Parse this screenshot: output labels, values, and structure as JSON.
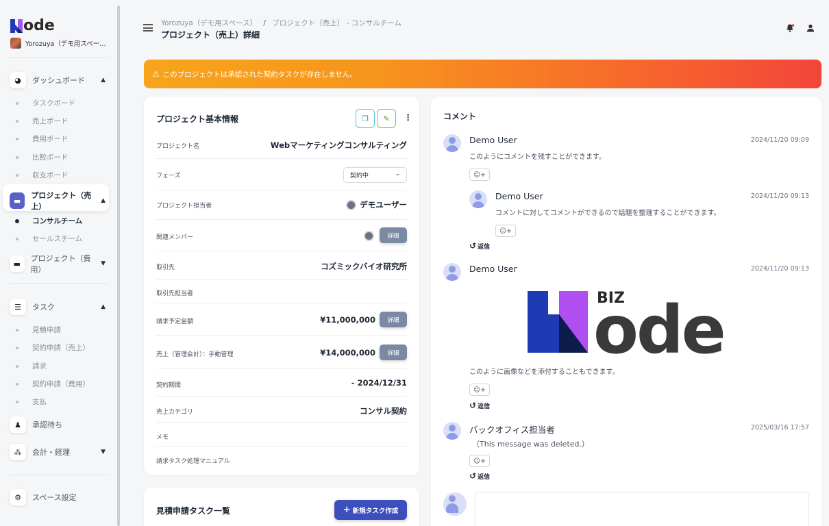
{
  "app": {
    "logo_text": "ode",
    "workspace": "Yorozuya（デモ用スペー…"
  },
  "sidebar": {
    "dashboard": {
      "label": "ダッシュボード",
      "items": [
        "タスクボード",
        "売上ボード",
        "費用ボード",
        "比較ボード",
        "収支ボード"
      ]
    },
    "project_sales": {
      "label": "プロジェクト（売上）",
      "items": [
        "コンサルチーム",
        "セールスチーム"
      ]
    },
    "project_cost": {
      "label": "プロジェクト（費用）"
    },
    "tasks": {
      "label": "タスク",
      "items": [
        "見積申請",
        "契約申請（売上）",
        "請求",
        "契約申請（費用）",
        "支払"
      ]
    },
    "approval": {
      "label": "承認待ち"
    },
    "accounting": {
      "label": "会計・経理"
    },
    "space_settings": {
      "label": "スペース設定"
    }
  },
  "header": {
    "breadcrumb_1": "Yorozuya（デモ用スペース）",
    "breadcrumb_sep": "/",
    "breadcrumb_2": "プロジェクト（売上） - コンサルチーム",
    "title": "プロジェクト（売上）詳細"
  },
  "alert": {
    "text": "このプロジェクトは承認された契約タスクが存在しません。"
  },
  "project_info": {
    "title": "プロジェクト基本情報",
    "rows": [
      {
        "label": "プロジェクト名",
        "value": "Webマーケティングコンサルティング"
      },
      {
        "label": "フェーズ",
        "value": "契約中"
      },
      {
        "label": "プロジェクト担当者",
        "value": "デモユーザー"
      },
      {
        "label": "関連メンバー",
        "value": "詳細"
      },
      {
        "label": "取引先",
        "value": "コズミックバイオ研究所"
      },
      {
        "label": "取引先担当者",
        "value": ""
      },
      {
        "label": "請求予定金額",
        "value": "¥11,000,000"
      },
      {
        "label": "売上（管理会計）：手動管理",
        "value": "¥14,000,000"
      },
      {
        "label": "契約期間",
        "value": "- 2024/12/31"
      },
      {
        "label": "売上カテゴリ",
        "value": "コンサル契約"
      },
      {
        "label": "メモ",
        "value": ""
      },
      {
        "label": "請求タスク処理マニュアル",
        "value": ""
      }
    ],
    "detail_label": "詳細"
  },
  "estimate_tasks": {
    "title": "見積申請タスク一覧",
    "new_button": "新規タスク作成"
  },
  "comments": {
    "title": "コメント",
    "reply_label": "返信",
    "react_label": "☺+",
    "items": [
      {
        "name": "Demo User",
        "date": "2024/11/20 09:09",
        "text": "このようにコメントを残すことができます。"
      },
      {
        "name": "Demo User",
        "date": "2024/11/20 09:13",
        "text": "コメントに対してコメントができるので話題を整理することができます。"
      },
      {
        "name": "Demo User",
        "date": "2024/11/20 09:13",
        "text": "このように画像などを添付することもできます。",
        "image_text": "BIZ"
      },
      {
        "name": "バックオフィス担当者",
        "date": "2025/03/16 17:57",
        "text": "（This message was deleted.）"
      }
    ]
  },
  "colors": {
    "accent": "#5b5fc7",
    "alert_start": "#f7a51a",
    "alert_end": "#f3453a",
    "new_button": "#3d4ebd"
  }
}
